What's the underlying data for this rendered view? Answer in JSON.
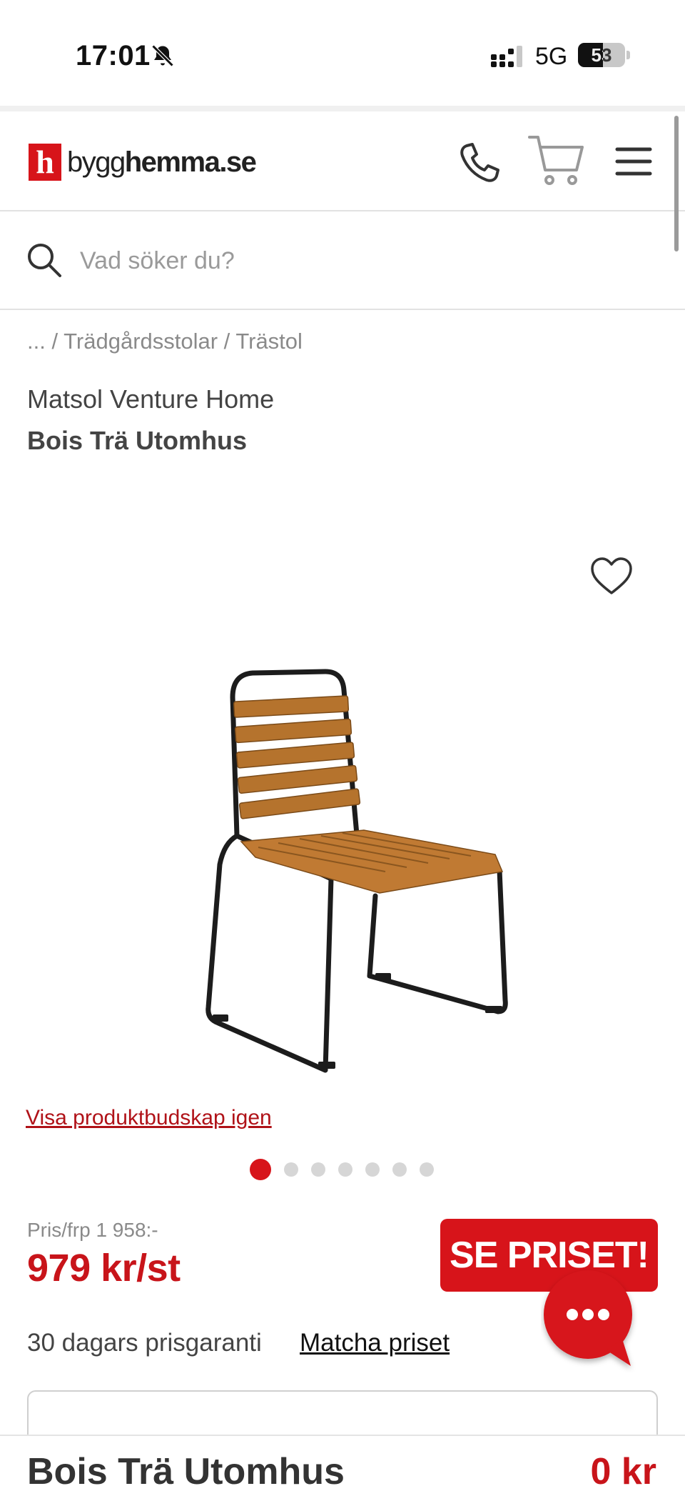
{
  "status_bar": {
    "time": "17:01",
    "network": "5G",
    "battery": "53",
    "battery_level": 0.53
  },
  "header": {
    "logo_mark": "h",
    "logo_text_light": "bygg",
    "logo_text_bold": "hemma",
    "logo_text_suffix": ".se"
  },
  "search": {
    "placeholder": "Vad söker du?",
    "value": ""
  },
  "breadcrumb": {
    "text": "... / Trädgårdsstolar / Trästol"
  },
  "product": {
    "brand": "Matsol Venture Home",
    "title": "Bois Trä Utomhus",
    "replay_link": "Visa produktbudskap igen",
    "image_count": 7,
    "active_image": 1
  },
  "pricing": {
    "old_price": "Pris/frp 1 958:-",
    "price": "979 kr/st",
    "cta": "SE PRISET!",
    "guarantee": "30 dagars prisgaranti",
    "match_link": "Matcha priset"
  },
  "sticky_footer": {
    "title": "Bois Trä Utomhus",
    "total": "0 kr"
  },
  "colors": {
    "brand_red": "#d7141a",
    "price_red": "#c8141a",
    "link_red": "#b01218"
  },
  "icons": [
    "bell-slash-icon",
    "signal-icon",
    "phone-icon",
    "cart-icon",
    "menu-icon",
    "search-icon",
    "heart-icon",
    "chat-icon"
  ]
}
